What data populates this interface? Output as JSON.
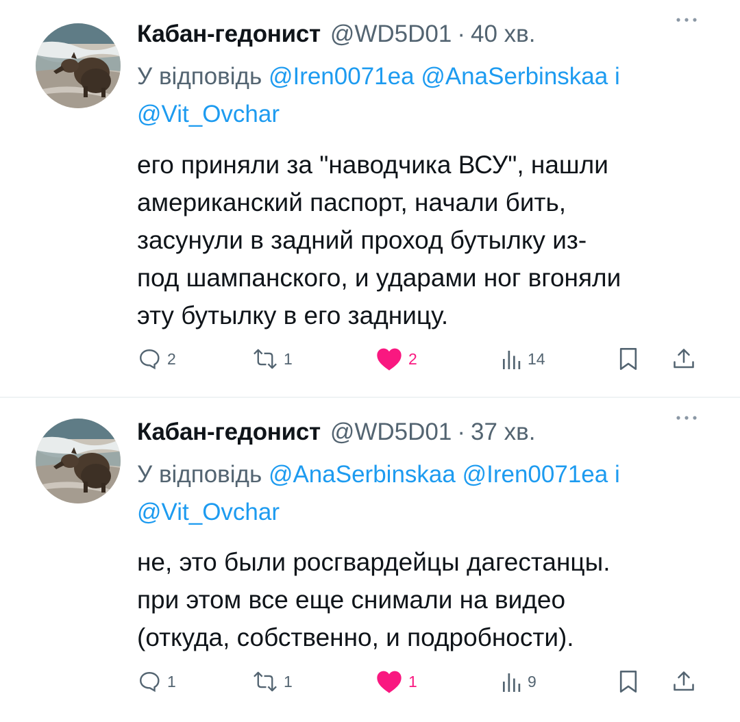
{
  "tweets": [
    {
      "author_name": "Кабан-гедонист",
      "handle": "@WD5D01",
      "separator": "·",
      "time": "40 хв.",
      "reply_prefix": "У відповідь",
      "mentions": [
        "@Iren0071ea",
        "@AnaSerbinskaa",
        "@Vit_Ovchar"
      ],
      "reply_and": "і",
      "text_lines": [
        "его приняли за \"наводчика ВСУ\", нашли",
        "американский паспорт, начали бить,",
        "засунули в задний проход бутылку из-",
        "под шампанского, и ударами ног вгоняли",
        "эту бутылку в его задницу."
      ],
      "stats": {
        "replies": "2",
        "retweets": "1",
        "likes": "2",
        "views": "14"
      },
      "liked": true
    },
    {
      "author_name": "Кабан-гедонист",
      "handle": "@WD5D01",
      "separator": "·",
      "time": "37 хв.",
      "reply_prefix": "У відповідь",
      "mentions": [
        "@AnaSerbinskaa",
        "@Iren0071ea",
        "@Vit_Ovchar"
      ],
      "reply_and": "і",
      "text_lines": [
        "не, это были росгвардейцы дагестанцы.",
        "при этом все еще снимали на видео",
        "(откуда, собственно, и подробности)."
      ],
      "stats": {
        "replies": "1",
        "retweets": "1",
        "likes": "1",
        "views": "9"
      },
      "liked": true
    }
  ],
  "icons": {
    "reply": "reply-bubble-icon",
    "retweet": "retweet-icon",
    "like": "heart-icon",
    "views": "views-bar-icon",
    "bookmark": "bookmark-icon",
    "share": "share-icon",
    "more": "more-dots-icon"
  },
  "colors": {
    "text_primary": "#0f1419",
    "text_secondary": "#536471",
    "mention": "#1d9bf0",
    "like": "#f91880",
    "divider": "#eff3f4"
  }
}
